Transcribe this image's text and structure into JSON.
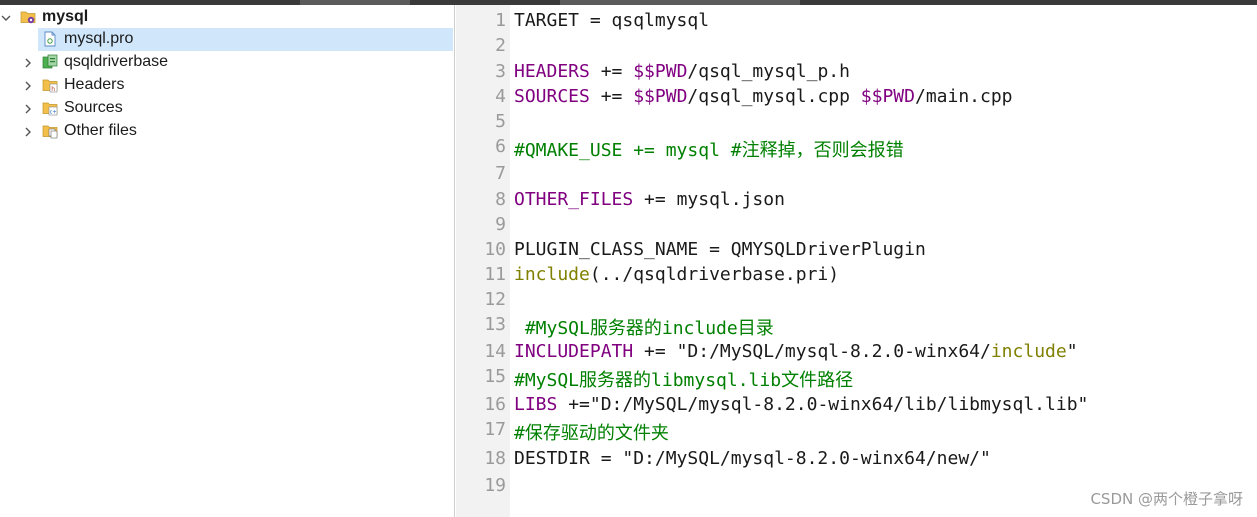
{
  "project_tree": {
    "root": {
      "label": "mysql"
    },
    "items": [
      {
        "label": "mysql.pro",
        "icon": "pro-file-icon",
        "selected": true
      },
      {
        "label": "qsqldriverbase",
        "icon": "subproject-icon"
      },
      {
        "label": "Headers",
        "icon": "headers-folder-icon"
      },
      {
        "label": "Sources",
        "icon": "sources-folder-icon"
      },
      {
        "label": "Other files",
        "icon": "other-files-folder-icon"
      }
    ]
  },
  "editor": {
    "lines": [
      {
        "n": "1",
        "tokens": [
          {
            "t": "TARGET = qsqlmysql",
            "c": "plain"
          }
        ]
      },
      {
        "n": "2",
        "tokens": []
      },
      {
        "n": "3",
        "tokens": [
          {
            "t": "HEADERS",
            "c": "kw"
          },
          {
            "t": " += ",
            "c": "plain"
          },
          {
            "t": "$$PWD",
            "c": "kw"
          },
          {
            "t": "/qsql_mysql_p.h",
            "c": "plain"
          }
        ]
      },
      {
        "n": "4",
        "tokens": [
          {
            "t": "SOURCES",
            "c": "kw"
          },
          {
            "t": " += ",
            "c": "plain"
          },
          {
            "t": "$$PWD",
            "c": "kw"
          },
          {
            "t": "/qsql_mysql.cpp ",
            "c": "plain"
          },
          {
            "t": "$$PWD",
            "c": "kw"
          },
          {
            "t": "/main.cpp",
            "c": "plain"
          }
        ]
      },
      {
        "n": "5",
        "tokens": []
      },
      {
        "n": "6",
        "tokens": [
          {
            "t": "#QMAKE_USE += mysql #注释掉，否则会报错",
            "c": "cm"
          }
        ]
      },
      {
        "n": "7",
        "tokens": []
      },
      {
        "n": "8",
        "tokens": [
          {
            "t": "OTHER_FILES",
            "c": "kw"
          },
          {
            "t": " += mysql.json",
            "c": "plain"
          }
        ]
      },
      {
        "n": "9",
        "tokens": []
      },
      {
        "n": "10",
        "tokens": [
          {
            "t": "PLUGIN_CLASS_NAME = QMYSQLDriverPlugin",
            "c": "plain"
          }
        ]
      },
      {
        "n": "11",
        "tokens": [
          {
            "t": "include",
            "c": "fn"
          },
          {
            "t": "(../qsqldriverbase.pri)",
            "c": "plain"
          }
        ]
      },
      {
        "n": "12",
        "tokens": []
      },
      {
        "n": "13",
        "tokens": [
          {
            "t": " #MySQL服务器的include目录",
            "c": "cm"
          }
        ]
      },
      {
        "n": "14",
        "tokens": [
          {
            "t": "INCLUDEPATH",
            "c": "kw"
          },
          {
            "t": " += \"D:/MySQL/mysql-8.2.0-winx64/",
            "c": "plain"
          },
          {
            "t": "include",
            "c": "fn"
          },
          {
            "t": "\"",
            "c": "plain"
          }
        ]
      },
      {
        "n": "15",
        "tokens": [
          {
            "t": "#MySQL服务器的libmysql.lib文件路径",
            "c": "cm"
          }
        ]
      },
      {
        "n": "16",
        "tokens": [
          {
            "t": "LIBS",
            "c": "kw"
          },
          {
            "t": " +=\"D:/MySQL/mysql-8.2.0-winx64/lib/libmysql.lib\"",
            "c": "plain"
          }
        ]
      },
      {
        "n": "17",
        "tokens": [
          {
            "t": "#保存驱动的文件夹",
            "c": "cm"
          }
        ]
      },
      {
        "n": "18",
        "tokens": [
          {
            "t": "DESTDIR = \"D:/MySQL/mysql-8.2.0-winx64/new/\"",
            "c": "plain"
          }
        ]
      },
      {
        "n": "19",
        "tokens": []
      }
    ]
  },
  "watermark": "CSDN @两个橙子拿呀",
  "colors": {
    "keyword": "#800080",
    "comment": "#008000",
    "function": "#808000",
    "selection": "#cfe6fb",
    "gutter": "#f2f2f2"
  }
}
